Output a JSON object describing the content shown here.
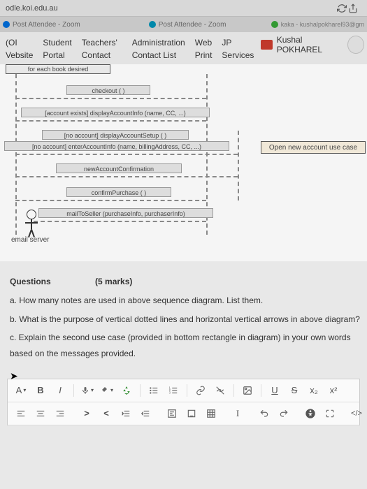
{
  "address_bar": {
    "url": "odle.koi.edu.au"
  },
  "tabs": {
    "t1": "Post Attendee - Zoom",
    "t2": "Post Attendee - Zoom",
    "t3": "kaka - kushalpokharel93@gm"
  },
  "nav": {
    "c1a": "(OI",
    "c1b": "Vebsite",
    "c2a": "Student",
    "c2b": "Portal",
    "c3a": "Teachers'",
    "c3b": "Contact List",
    "c4a": "Administration",
    "c4b": "Contact List",
    "c5a": "Web",
    "c5b": "Print",
    "c6a": "JP",
    "c6b": "Services",
    "user": "Kushal POKHAREL"
  },
  "diagram": {
    "top_rect": "for each book desired",
    "open_rect": "Open new account use case",
    "msg_checkout": "checkout ( )",
    "msg_display_acct": "[account exists] displayAccountInfo (name, CC, ...)",
    "msg_no_acct_setup": "[no account] displayAccountSetup ( )",
    "msg_enter_acct": "[no account] enterAccountInfo (name, billingAddress, CC, ...)",
    "msg_new_conf": "newAccountConfirmation",
    "msg_confirm": "confirmPurchase ( )",
    "msg_mail": "mailToSeller (purchaseInfo, purchaserInfo)",
    "actor": "email server"
  },
  "questions": {
    "heading": "Questions",
    "marks": "(5 marks)",
    "a": "a.    How many notes are used in above sequence diagram. List them.",
    "b": "b.    What is the purpose of vertical dotted lines and horizontal vertical arrows in above diagram?",
    "c": "c.    Explain the second use case (provided in bottom rectangle in diagram) in your own words",
    "c2": "based on the messages provided."
  },
  "toolbar": {
    "a": "A",
    "b": "B",
    "i": "I",
    "u": "U",
    "s": "S",
    "x2": "x₂",
    "xsup": "x²"
  }
}
